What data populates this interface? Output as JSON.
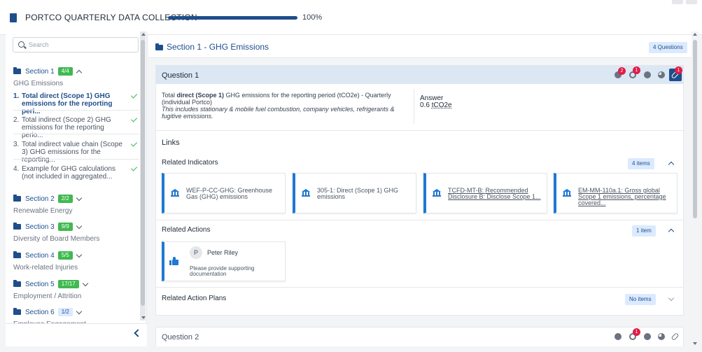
{
  "header": {
    "title": "PORTCO QUARTERLY DATA COLLECTION",
    "progress_percent": 100,
    "progress_label": "100%"
  },
  "sidebar": {
    "search_placeholder": "Search",
    "sections": [
      {
        "label": "Section 1",
        "badge": "4/4",
        "name": "GHG Emissions"
      },
      {
        "label": "Section 2",
        "badge": "2/2",
        "name": "Renewable Energy"
      },
      {
        "label": "Section 3",
        "badge": "9/9",
        "name": "Diversity of Board Members"
      },
      {
        "label": "Section 4",
        "badge": "5/5",
        "name": "Work-related Injuries"
      },
      {
        "label": "Section 5",
        "badge": "17/17",
        "name": "Employment / Attrition"
      },
      {
        "label": "Section 6",
        "badge": "1/2",
        "name": "Employee Engagement"
      }
    ],
    "questions": [
      {
        "num": "1.",
        "text": "Total direct (Scope 1) GHG emissions for the reporting peri..."
      },
      {
        "num": "2.",
        "text": "Total indirect (Scope 2) GHG emissions for the reporting perio..."
      },
      {
        "num": "3.",
        "text": "Total indirect value chain (Scope 3) GHG emissions for the reporting..."
      },
      {
        "num": "4.",
        "text": "Example for GHG calculations (not included in aggregated..."
      }
    ]
  },
  "main": {
    "section_prefix": "Section 1 - ",
    "section_name": "GHG Emissions",
    "questions_count": "4 Questions",
    "question1": {
      "title": "Question 1",
      "text_before": "Total ",
      "text_bold": "direct (Scope 1)",
      "text_after": " GHG emissions for the reporting period (tCO2e) - Quarterly (individual Portco)",
      "note": "This includes stationary & mobile fuel combustion, company vehicles, refrigerants & fugitive emissions.",
      "answer_label": "Answer",
      "answer_value": "0.6",
      "answer_unit": "tCO2e",
      "notif_chat": "2",
      "notif_target": "1",
      "notif_link": "1"
    },
    "links_title": "Links",
    "related_indicators": {
      "title": "Related Indicators",
      "count": "4 items",
      "items": [
        "WEF-P-CC-GHG: Greenhouse Gas (GHG) emissions",
        "305-1: Direct (Scope 1) GHG emissions",
        "TCFD-MT-B: Recommended Disclosure B: Disclose Scope 1...",
        "EM-MM-110a.1: Gross global Scope 1 emissions, percentage covered..."
      ]
    },
    "related_actions": {
      "title": "Related Actions",
      "count": "1 item",
      "avatar_initial": "P",
      "person": "Peter Riley",
      "note": "Please provide supporting documentation"
    },
    "related_action_plans": {
      "title": "Related Action Plans",
      "count": "No items"
    },
    "question2": {
      "title": "Question 2",
      "notif_target": "1"
    }
  },
  "colors": {
    "brand": "#1f4e8c",
    "accent": "#1f78d1",
    "success": "#3fb950",
    "notification": "#e11d48"
  }
}
